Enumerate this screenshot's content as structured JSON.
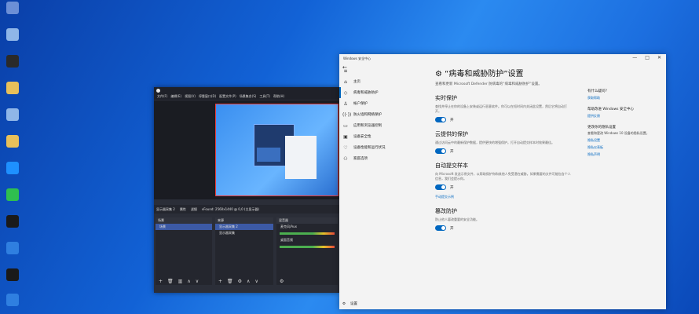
{
  "desktop": {
    "icons": [
      {
        "label": "",
        "color": "#6c8fd6"
      },
      {
        "label": "",
        "color": "#8fb6e8"
      },
      {
        "label": "",
        "color": "#2a2a2a"
      },
      {
        "label": "",
        "color": "#e8c05a"
      },
      {
        "label": "",
        "color": "#8fb6e8"
      },
      {
        "label": "",
        "color": "#e8c05a"
      },
      {
        "label": "",
        "color": "#1e90ff"
      },
      {
        "label": "",
        "color": "#2fbf4f"
      },
      {
        "label": "",
        "color": "#1a1a1a"
      },
      {
        "label": "",
        "color": "#2f7fe0"
      },
      {
        "label": "",
        "color": "#1a1a1a"
      },
      {
        "label": "",
        "color": "#2f7fe0"
      },
      {
        "label": "",
        "color": "#2f7fe0"
      },
      {
        "label": "",
        "color": "#c0208a"
      },
      {
        "label": "",
        "color": "#c0208a"
      }
    ]
  },
  "obs": {
    "menu": [
      "文件(F)",
      "编辑(E)",
      "视图(V)",
      "停靠窗口(D)",
      "配置文件(P)",
      "场景集合(S)",
      "工具(T)",
      "帮助(H)"
    ],
    "scene_label": "显示器采集 2",
    "props_label": "属性",
    "filters_label": "滤镜",
    "resolution": "vFound: 2560x1440 @ 0,0 (主显示器)",
    "scenes_title": "场景",
    "scene_item": "场景",
    "sources_title": "来源",
    "sources": [
      "显示器采集 2",
      "显示器采集"
    ],
    "mixer_title": "混音器",
    "mixer_tracks": [
      "麦克风/Aux",
      "桌面音频"
    ]
  },
  "security": {
    "window_title": "Windows 安全中心",
    "nav": [
      {
        "icon": "≡",
        "label": ""
      },
      {
        "icon": "⌂",
        "label": "主页"
      },
      {
        "icon": "◇",
        "label": "病毒和威胁防护"
      },
      {
        "icon": "♙",
        "label": "帐户保护"
      },
      {
        "icon": "((·))",
        "label": "防火墙和网络保护"
      },
      {
        "icon": "▭",
        "label": "应用和浏览器控制"
      },
      {
        "icon": "▣",
        "label": "设备安全性"
      },
      {
        "icon": "♡",
        "label": "设备性能和运行状况"
      },
      {
        "icon": "⚇",
        "label": "家庭选项"
      }
    ],
    "settings_label": "设置",
    "page_title": "“病毒和威胁防护”设置",
    "page_subtitle": "查看和更新 Microsoft Defender 防病毒的“病毒和威胁防护”设置。",
    "sections": [
      {
        "title": "实时保护",
        "desc": "查找并停止在你的设备上安装或运行恶意软件。你可以在短时间内关闭此设置，然后它将自动打开。",
        "toggle": "开",
        "link": ""
      },
      {
        "title": "云提供的保护",
        "desc": "通过访问云中的最新保护数据，提供更快的增强保护。打开自动提交样本时效果最佳。",
        "toggle": "开",
        "link": ""
      },
      {
        "title": "自动提交样本",
        "desc": "向 Microsoft 发送示例文件，以帮助保护你和其他人免受潜在威胁。如果需要的文件可能包含个人信息，我们会提示你。",
        "toggle": "开",
        "link": "手动提交示例"
      },
      {
        "title": "篡改防护",
        "desc": "防止他人篡改重要的安全功能。",
        "toggle": "开",
        "link": ""
      }
    ],
    "side": {
      "q1": "有什么疑问?",
      "q1_link": "获取帮助",
      "q2": "帮助改进 Windows 安全中心",
      "q2_link": "提供反馈",
      "q3": "更改你的隐私设置",
      "q3_desc": "查看和更改 Windows 10 设备的隐私设置。",
      "q3_links": [
        "隐私设置",
        "隐私仪表板",
        "隐私声明"
      ]
    }
  }
}
